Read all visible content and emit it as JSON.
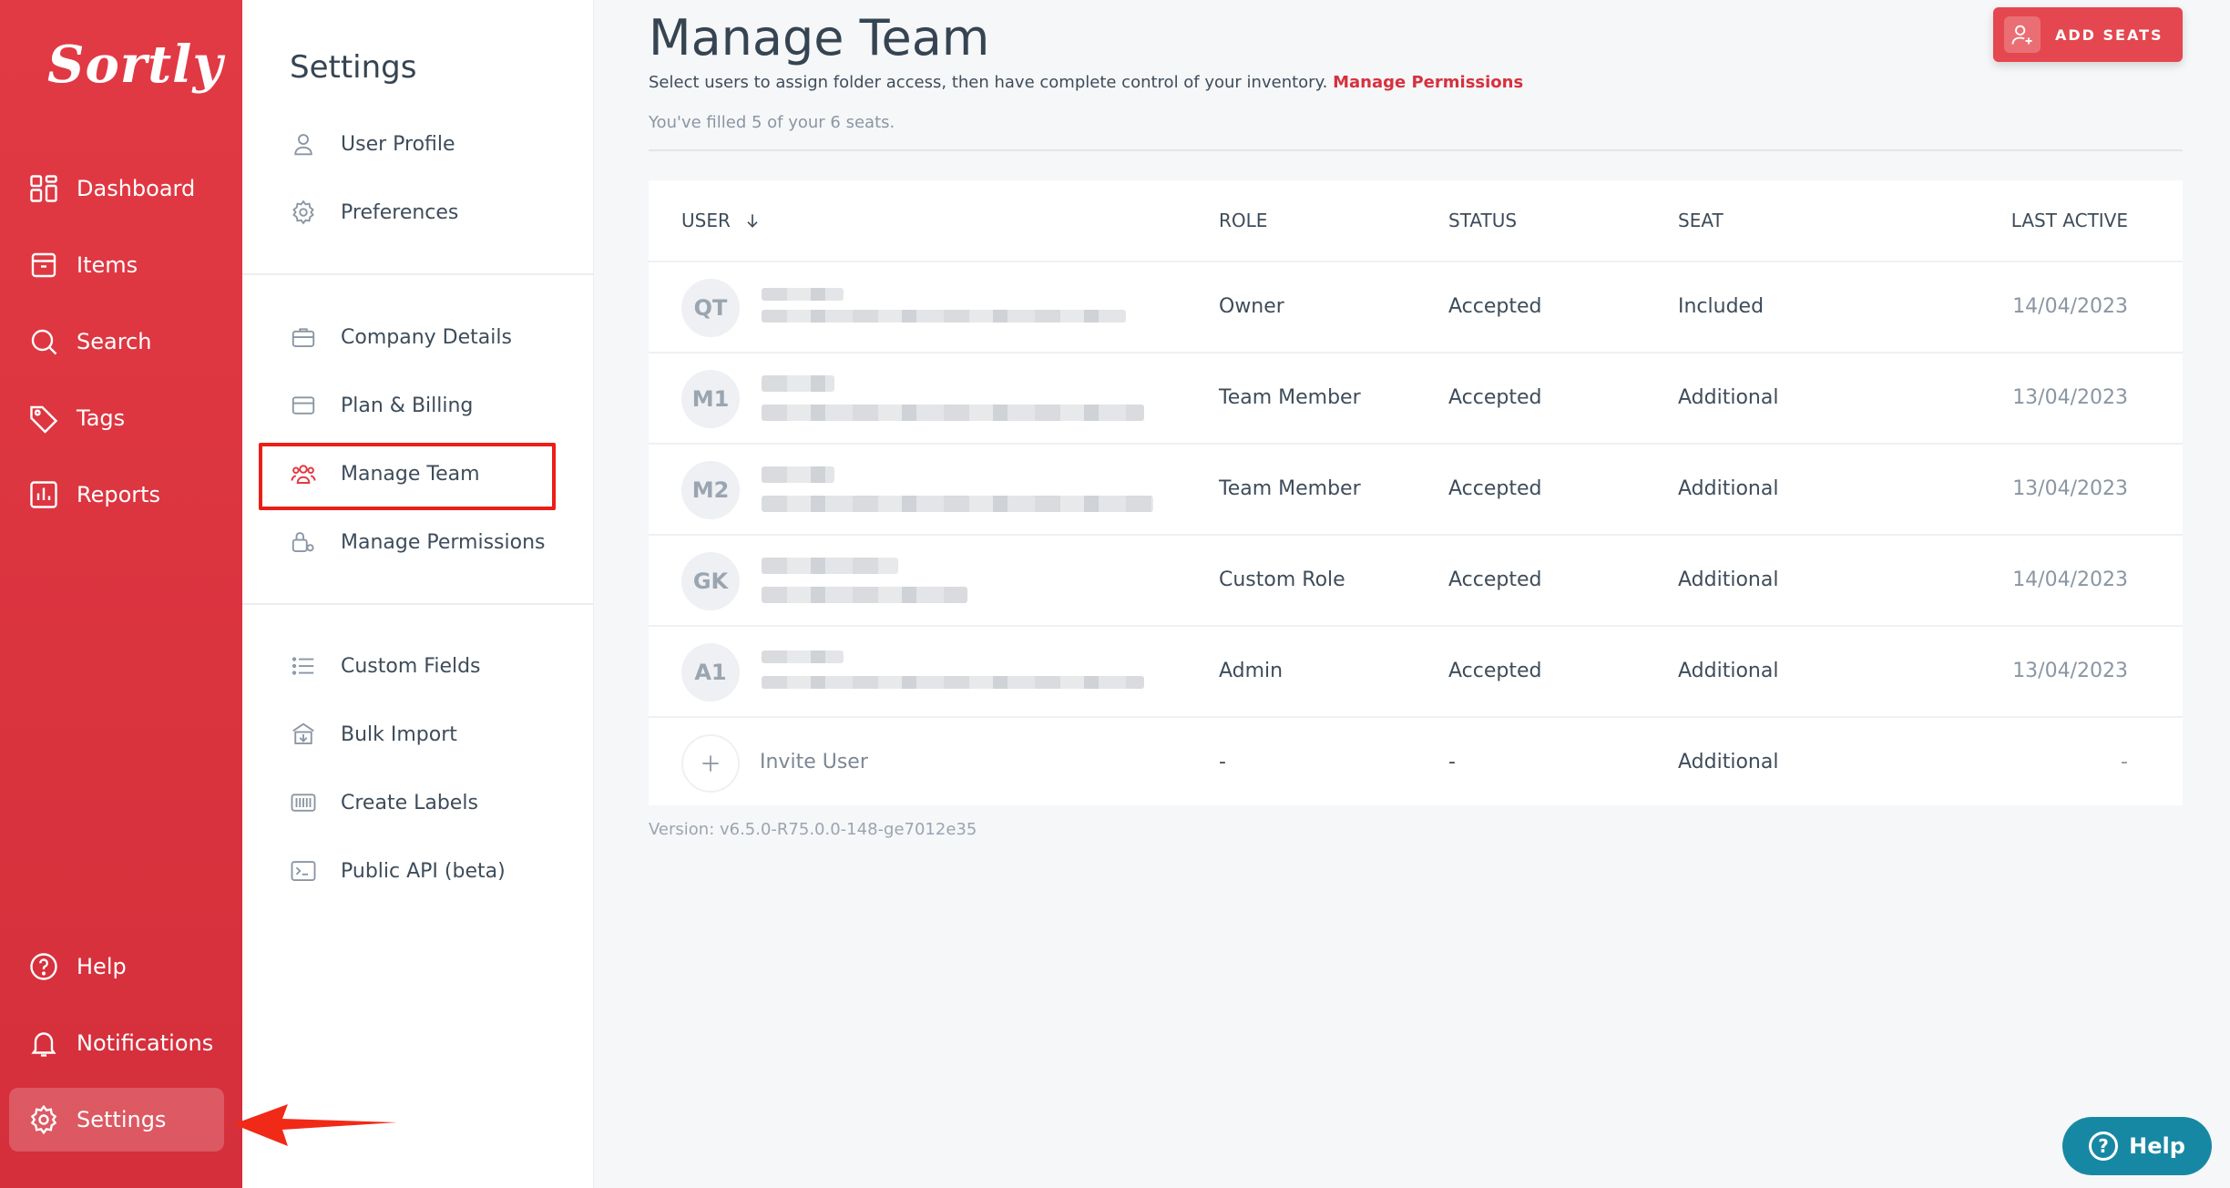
{
  "app": {
    "logo": "Sortly",
    "nav": [
      {
        "label": "Dashboard",
        "icon": "dashboard-icon"
      },
      {
        "label": "Items",
        "icon": "items-icon"
      },
      {
        "label": "Search",
        "icon": "search-icon"
      },
      {
        "label": "Tags",
        "icon": "tag-icon"
      },
      {
        "label": "Reports",
        "icon": "reports-icon"
      }
    ],
    "bottom_nav": [
      {
        "label": "Help",
        "icon": "help-icon"
      },
      {
        "label": "Notifications",
        "icon": "bell-icon"
      },
      {
        "label": "Settings",
        "icon": "gear-icon",
        "active": true
      }
    ],
    "brand_color": "#e23a44"
  },
  "settings": {
    "title": "Settings",
    "group1": [
      {
        "label": "User Profile",
        "icon": "user-icon"
      },
      {
        "label": "Preferences",
        "icon": "gear-icon"
      }
    ],
    "group2": [
      {
        "label": "Company Details",
        "icon": "briefcase-icon"
      },
      {
        "label": "Plan & Billing",
        "icon": "credit-card-icon"
      },
      {
        "label": "Manage Team",
        "icon": "team-icon",
        "active": true
      },
      {
        "label": "Manage Permissions",
        "icon": "lock-gear-icon"
      }
    ],
    "group3": [
      {
        "label": "Custom Fields",
        "icon": "list-icon"
      },
      {
        "label": "Bulk Import",
        "icon": "import-icon"
      },
      {
        "label": "Create Labels",
        "icon": "barcode-icon"
      },
      {
        "label": "Public API (beta)",
        "icon": "terminal-icon"
      }
    ]
  },
  "main": {
    "title": "Manage Team",
    "subtitle": "Select users to assign folder access, then have complete control of your inventory.",
    "subtitle_link": "Manage Permissions",
    "seat_note": "You've filled 5 of your 6 seats.",
    "add_seats_label": "ADD SEATS",
    "version": "Version: v6.5.0-R75.0.0-148-ge7012e35"
  },
  "table": {
    "columns": {
      "user": "USER",
      "role": "ROLE",
      "status": "STATUS",
      "seat": "SEAT",
      "last_active": "LAST ACTIVE"
    },
    "rows": [
      {
        "initials": "QT",
        "role": "Owner",
        "status": "Accepted",
        "seat": "Included",
        "last_active": "14/04/2023"
      },
      {
        "initials": "M1",
        "role": "Team Member",
        "status": "Accepted",
        "seat": "Additional",
        "last_active": "13/04/2023"
      },
      {
        "initials": "M2",
        "role": "Team Member",
        "status": "Accepted",
        "seat": "Additional",
        "last_active": "13/04/2023"
      },
      {
        "initials": "GK",
        "role": "Custom Role",
        "status": "Accepted",
        "seat": "Additional",
        "last_active": "14/04/2023"
      },
      {
        "initials": "A1",
        "role": "Admin",
        "status": "Accepted",
        "seat": "Additional",
        "last_active": "13/04/2023"
      }
    ],
    "invite": {
      "label": "Invite User",
      "role": "-",
      "status": "-",
      "seat": "Additional",
      "last_active": "-"
    }
  },
  "help_bubble": "Help"
}
